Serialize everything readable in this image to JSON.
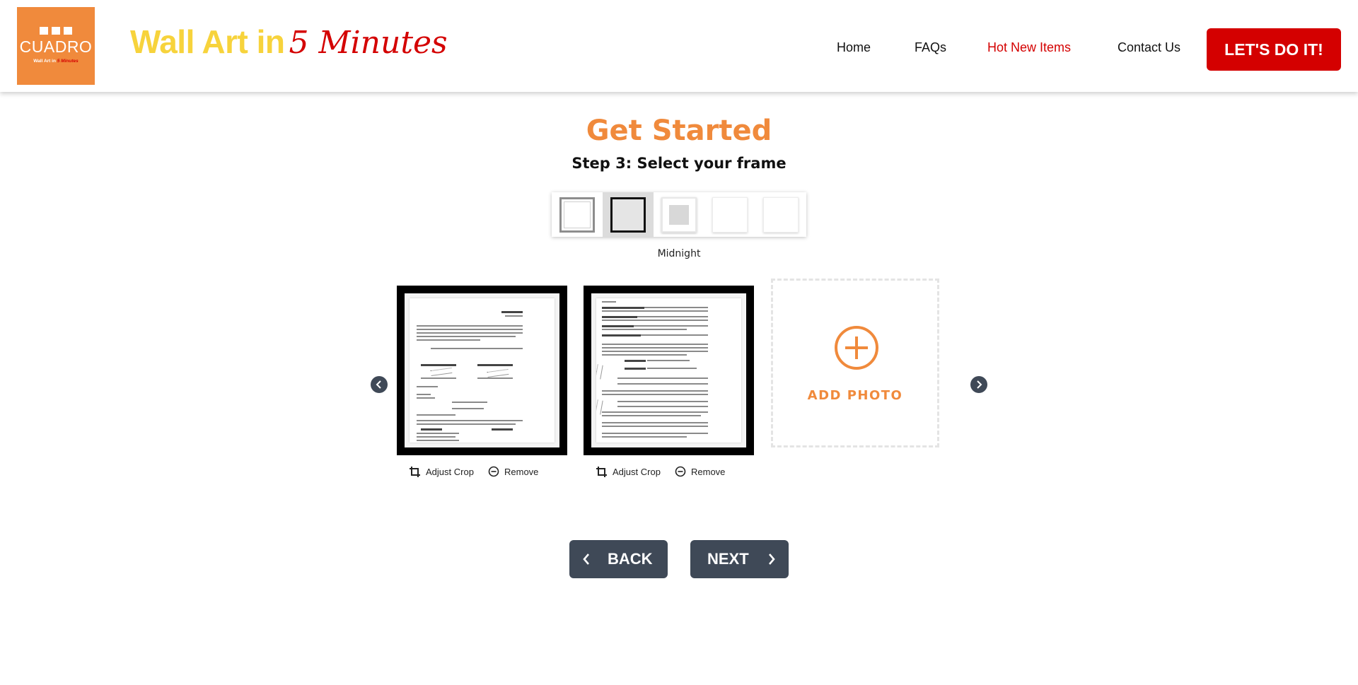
{
  "header": {
    "logo": {
      "name": "CUADRO",
      "tagline_prefix": "Wall Art in",
      "tagline_accent": "5 Minutes"
    },
    "title_main": "Wall Art in",
    "title_accent": "5 Minutes",
    "nav": [
      {
        "label": "Home",
        "active": false
      },
      {
        "label": "FAQs",
        "active": false
      },
      {
        "label": "Hot New Items",
        "active": true
      },
      {
        "label": "Contact Us",
        "active": false
      }
    ],
    "cta_label": "LET'S DO IT!"
  },
  "main": {
    "heading": "Get Started",
    "step_label": "Step 3: Select your frame",
    "frame_options": [
      {
        "icon": "frame-white-double",
        "selected": false
      },
      {
        "icon": "frame-black",
        "selected": true
      },
      {
        "icon": "frame-mat-shadow",
        "selected": false
      },
      {
        "icon": "frame-frameless",
        "selected": false
      },
      {
        "icon": "frame-plain",
        "selected": false
      }
    ],
    "selected_frame_name": "Midnight",
    "photos": [
      {
        "icon": "document-page-1",
        "adjust_label": "Adjust Crop",
        "remove_label": "Remove"
      },
      {
        "icon": "document-page-2",
        "adjust_label": "Adjust Crop",
        "remove_label": "Remove"
      }
    ],
    "add_photo_label": "ADD PHOTO",
    "back_label": "BACK",
    "next_label": "NEXT"
  },
  "colors": {
    "accent_orange": "#f08a3c",
    "brand_red": "#d40000",
    "title_yellow": "#f7d33c",
    "button_slate": "#3f4957"
  }
}
